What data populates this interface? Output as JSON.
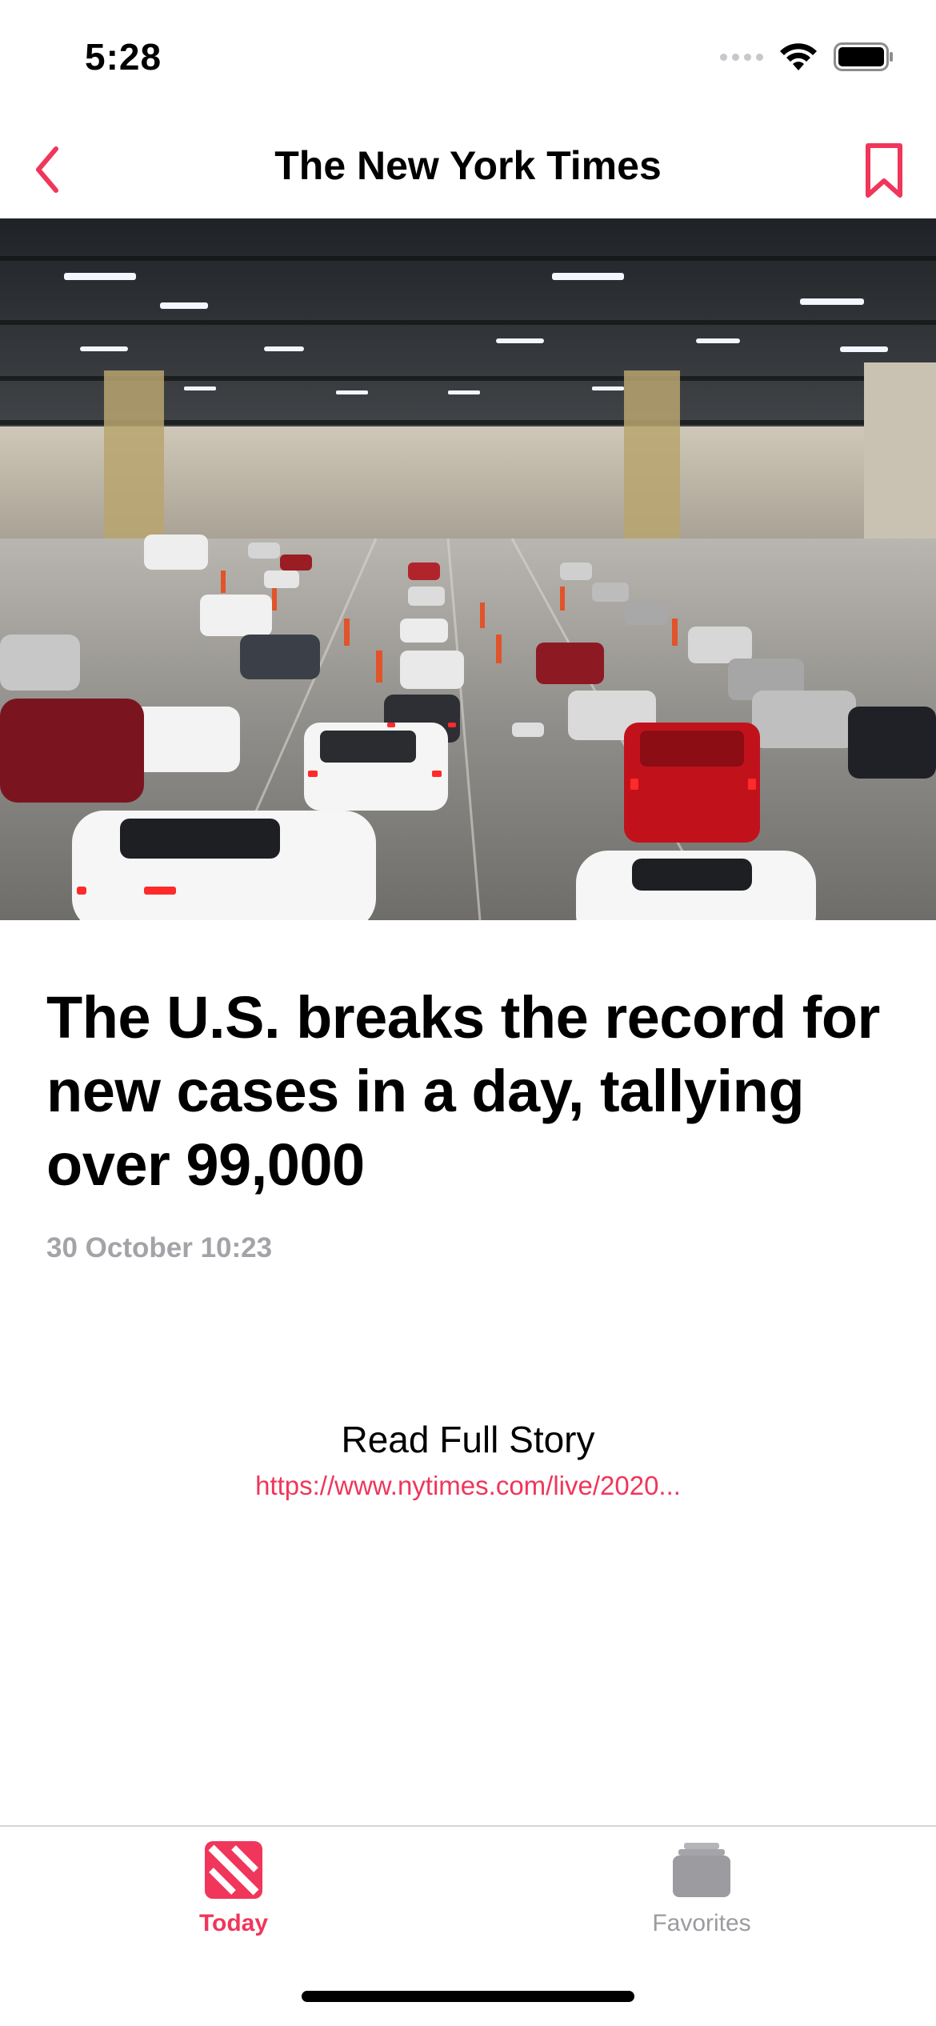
{
  "status_bar": {
    "time": "5:28",
    "icons": [
      "cellular-signal-icon",
      "wifi-icon",
      "battery-icon"
    ]
  },
  "nav": {
    "title": "The New York Times",
    "back_icon": "chevron-left-icon",
    "bookmark_icon": "bookmark-icon"
  },
  "hero_image": {
    "description_icon": "photo"
  },
  "article": {
    "headline": "The U.S. breaks the record for new cases in a day, tallying over 99,000",
    "date": "30 October 10:23",
    "read_full_label": "Read Full Story",
    "link": "https://www.nytimes.com/live/2020..."
  },
  "tab_bar": {
    "tabs": [
      {
        "label": "Today",
        "icon": "news-icon",
        "selected": true
      },
      {
        "label": "Favorites",
        "icon": "favorites-stack-icon",
        "selected": false
      }
    ]
  },
  "colors": {
    "accent": "#f0365b",
    "secondary_text": "#a3a3a8",
    "tab_inactive": "#9b9ba0"
  }
}
